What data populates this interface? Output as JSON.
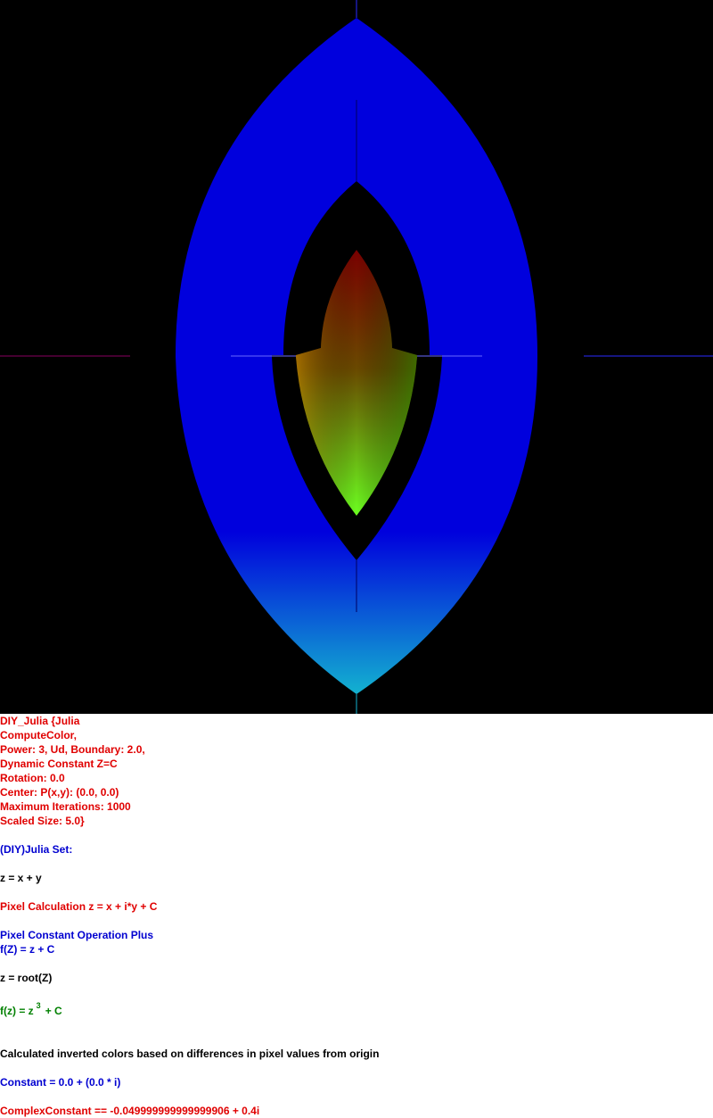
{
  "colors": {
    "background": "#000000",
    "outer_top": "#0000dd",
    "outer_bottom": "#13b2d0",
    "inner_top": "#7a0000",
    "inner_bottom": "#6cff20",
    "inner_left": "#c89000",
    "inner_right": "#2a8a00",
    "text_red": "#e00000",
    "text_blue": "#0000d0",
    "text_black": "#000000",
    "text_green": "#008000"
  },
  "info": {
    "title": "DIY_Julia {Julia",
    "compute_color": "ComputeColor,",
    "power_line": "Power: 3, Ud, Boundary: 2.0,",
    "dynamic_constant": "Dynamic Constant Z=C",
    "rotation": "Rotation: 0.0",
    "center": "Center: P(x,y): (0.0, 0.0)",
    "max_iterations": "Maximum Iterations: 1000",
    "scaled_size": "Scaled Size: 5.0}",
    "set_name": "(DIY)Julia Set:",
    "z_eq": "z = x + y",
    "pixel_calc": "Pixel Calculation z = x + i*y + C",
    "pixel_const_op": "Pixel Constant Operation Plus",
    "fz_eq": "f(Z) = z + C",
    "z_root": "z = root(Z)",
    "formula_lhs": "f(z) = z",
    "formula_exp": "3",
    "formula_rhs": "+ C",
    "inverted_colors": "Calculated inverted colors based on differences in pixel values from origin",
    "constant": "Constant = 0.0 + (0.0 * i)",
    "complex_constant": "ComplexConstant == -0.049999999999999906 + 0.4i"
  }
}
